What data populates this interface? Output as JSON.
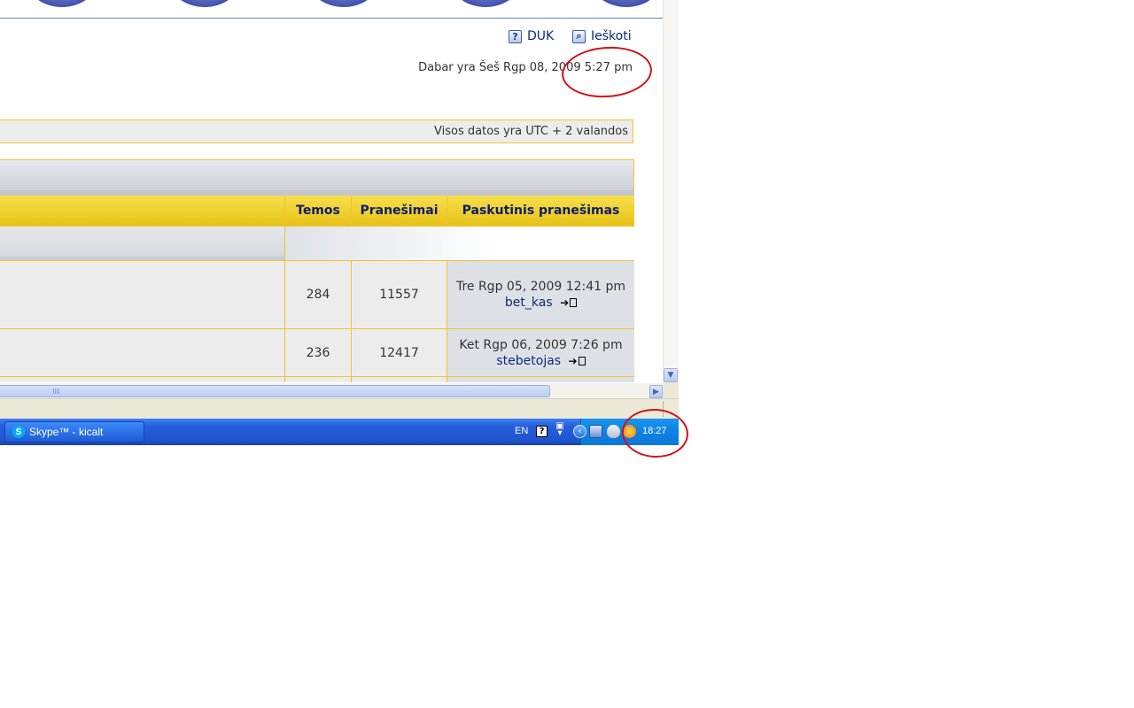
{
  "header": {
    "faq_label": "DUK",
    "search_label": "Ieškoti",
    "current_time": "Dabar yra Šeš Rgp 08, 2009 5:27 pm"
  },
  "timezone_note": "Visos datos yra UTC + 2 valandos",
  "forum_table": {
    "columns": [
      "",
      "Temos",
      "Pranešimai",
      "Paskutinis pranešimas"
    ],
    "rows": [
      {
        "topics": "284",
        "posts": "11557",
        "last_post_date": "Tre Rgp 05, 2009 12:41 pm",
        "last_post_user": "bet_kas"
      },
      {
        "topics": "236",
        "posts": "12417",
        "last_post_date": "Ket Rgp 06, 2009 7:26 pm",
        "last_post_user": "stebetojas"
      }
    ]
  },
  "taskbar": {
    "task_label": "Skype™ - kicalt",
    "language": "EN",
    "clock": "18:27"
  },
  "annotation_color": "#d0121a",
  "accent_color": "#f1c232"
}
